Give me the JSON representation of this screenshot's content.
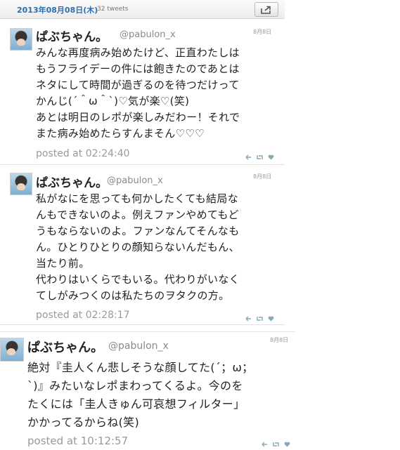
{
  "header": {
    "date": "2013年08月08日(木)",
    "tweet_count": "32 tweets"
  },
  "tweets": [
    {
      "name": "ぱぶちゃん。",
      "handle": "@pabulon_x",
      "date": "8月8日",
      "text": "みんな再度病み始めたけど、正直わたしは\nもうフライデーの件には飽きたのであとは\nネタにして時間が過ぎるのを待つだけって\nかんじ(´＾ω＾`)♡気が楽♡(笑)\nあとは明日のレポが楽しみだわー！それで\nまた病み始めたらすんまそん♡♡♡",
      "posted": "posted at 02:24:40"
    },
    {
      "name": "ぱぶちゃん。",
      "handle": "@pabulon_x",
      "date": "8月8日",
      "text": "私がなにを思っても何かしたくても結局な\nんもできないのよ。例えファンやめてもど\nうもならないのよ。ファンなんてそんなも\nん。ひとりひとりの顔知らないんだもん、\n当たり前。\n代わりはいくらでもいる。代わりがいなく\nてしがみつくのは私たちのヲタクの方。",
      "posted": "posted at 02:28:17"
    },
    {
      "name": "ぱぶちゃん。",
      "handle": "@pabulon_x",
      "date": "8月8日",
      "text": "絶対『圭人くん悲しそうな顔してた(´；ω；\n`)』みたいなレポまわってくるよ。今のを\nたくには「圭人きゅん可哀想フィルター」\nかかってるからね(笑)",
      "posted": "posted at 10:12:57"
    }
  ]
}
